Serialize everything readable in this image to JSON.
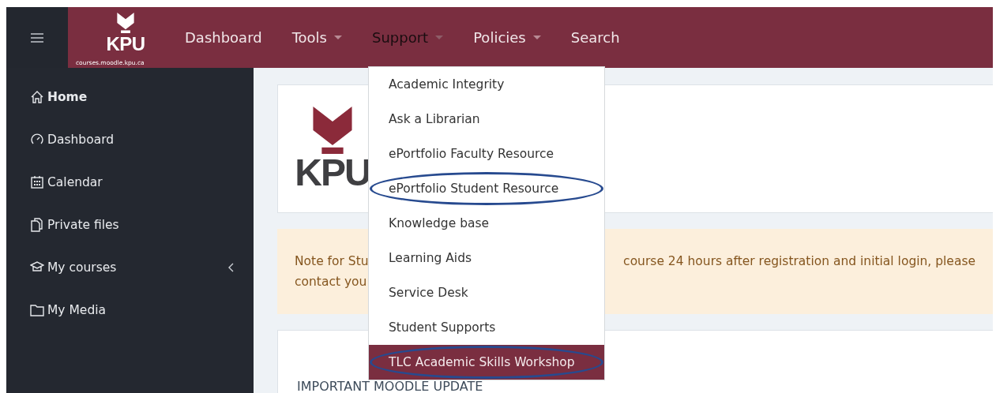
{
  "brand": {
    "site": "KPU",
    "subtitle": "courses.moodle.kpu.ca"
  },
  "nav": [
    {
      "label": "Dashboard",
      "dropdown": false,
      "open": false
    },
    {
      "label": "Tools",
      "dropdown": true,
      "open": false
    },
    {
      "label": "Support",
      "dropdown": true,
      "open": true
    },
    {
      "label": "Policies",
      "dropdown": true,
      "open": false
    },
    {
      "label": "Search",
      "dropdown": false,
      "open": false
    }
  ],
  "sidebar": {
    "items": [
      {
        "kind": "home",
        "label": "Home",
        "selected": true
      },
      {
        "kind": "dashboard",
        "label": "Dashboard",
        "selected": false
      },
      {
        "kind": "calendar",
        "label": "Calendar",
        "selected": false
      },
      {
        "kind": "files",
        "label": "Private files",
        "selected": false
      },
      {
        "kind": "courses",
        "label": "My courses",
        "selected": false,
        "expanded": false
      },
      {
        "kind": "media",
        "label": "My Media",
        "selected": false
      }
    ]
  },
  "support_menu": [
    {
      "label": "Academic Integrity",
      "selected": false,
      "circled": false
    },
    {
      "label": "Ask a Librarian",
      "selected": false,
      "circled": false
    },
    {
      "label": "ePortfolio Faculty Resource",
      "selected": false,
      "circled": false
    },
    {
      "label": "ePortfolio Student Resource",
      "selected": false,
      "circled": true
    },
    {
      "label": "Knowledge base",
      "selected": false,
      "circled": false
    },
    {
      "label": "Learning Aids",
      "selected": false,
      "circled": false
    },
    {
      "label": "Service Desk",
      "selected": false,
      "circled": false
    },
    {
      "label": "Student Supports",
      "selected": false,
      "circled": false
    },
    {
      "label": "TLC Academic Skills Workshop",
      "selected": true,
      "circled": true
    }
  ],
  "logo_card": {
    "logo": "KPU"
  },
  "notice": {
    "lines": [
      [
        "Note for Stu",
        "course 24 hours after registration and initial login, please"
      ],
      [
        "contact you"
      ]
    ]
  },
  "section": {
    "heading": "IMPORTANT MOODLE UPDATE"
  }
}
